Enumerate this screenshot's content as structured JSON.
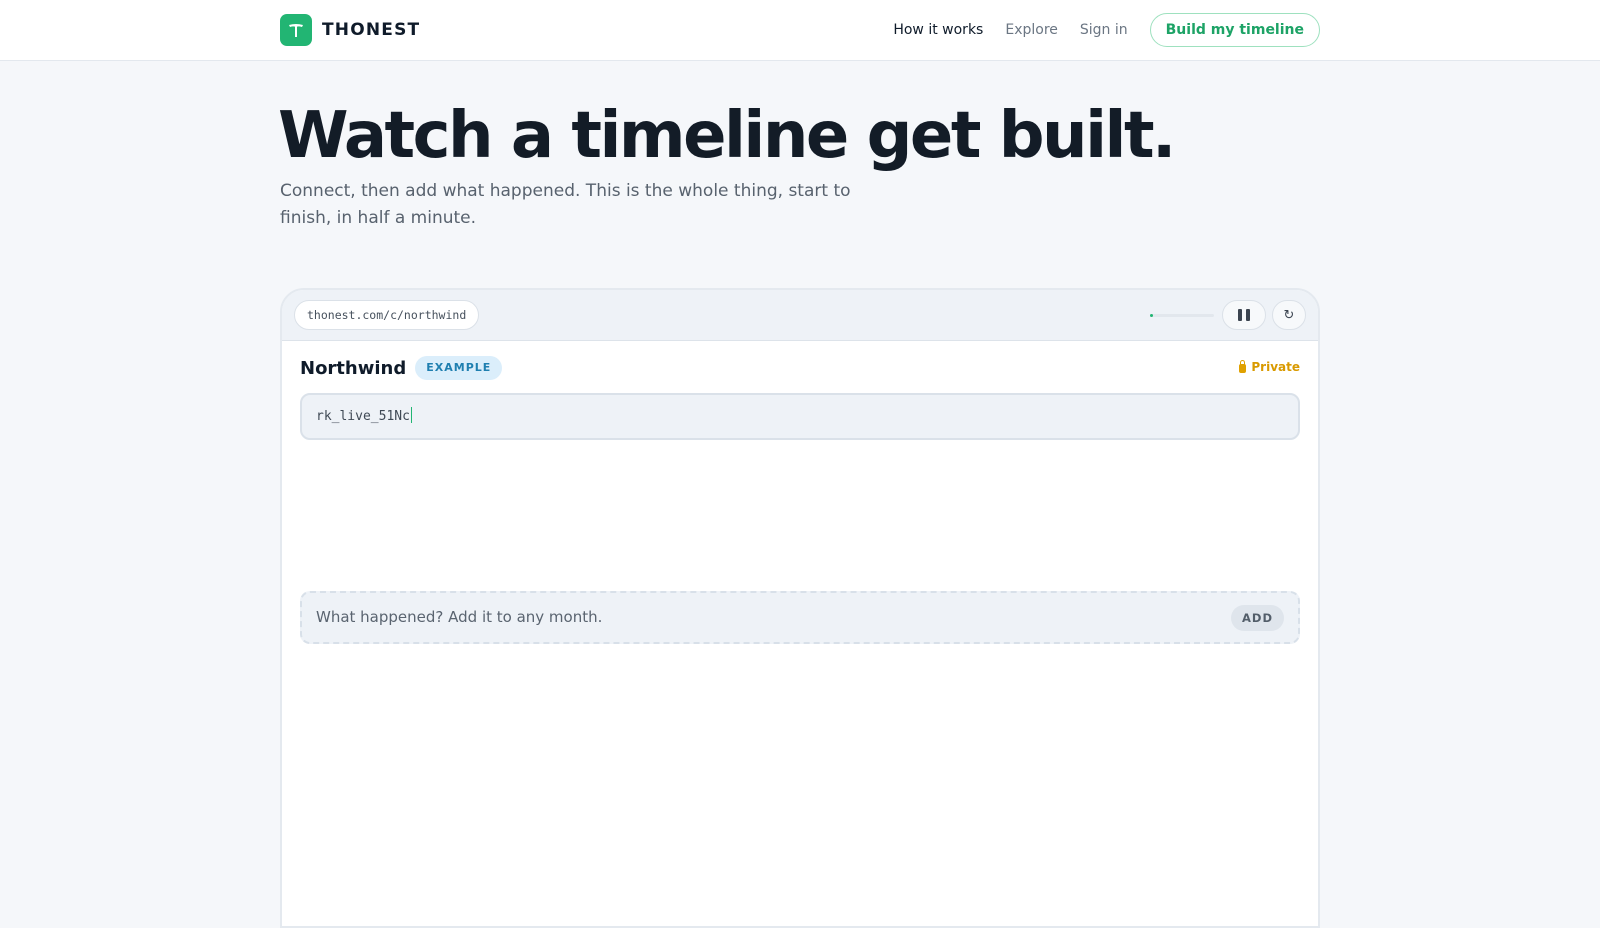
{
  "nav": {
    "brand": "THONEST",
    "links": [
      {
        "label": "How it works",
        "active": true
      },
      {
        "label": "Explore",
        "active": false
      },
      {
        "label": "Sign in",
        "active": false
      }
    ],
    "cta": "Build my timeline"
  },
  "hero": {
    "title": "Watch a timeline get built.",
    "subtitle": "Connect, then add what happened. This is the whole thing, start to finish, in half a minute."
  },
  "demo": {
    "url": "thonest.com/c/northwind",
    "progress": 0.05,
    "pause_icon": "pause-icon",
    "restart_icon": "restart-icon",
    "restart_glyph": "↻",
    "company": "Northwind",
    "badge": "EXAMPLE",
    "privacy": "Private",
    "privacy_icon": "lock-icon",
    "key_value": "rk_live_51Nc",
    "add_placeholder": "What happened? Add it to any month.",
    "add_button": "ADD"
  },
  "colors": {
    "accent": "#22b573",
    "private": "#d99a00",
    "badge_bg": "#dbeefb",
    "badge_text": "#1f7fb0"
  }
}
